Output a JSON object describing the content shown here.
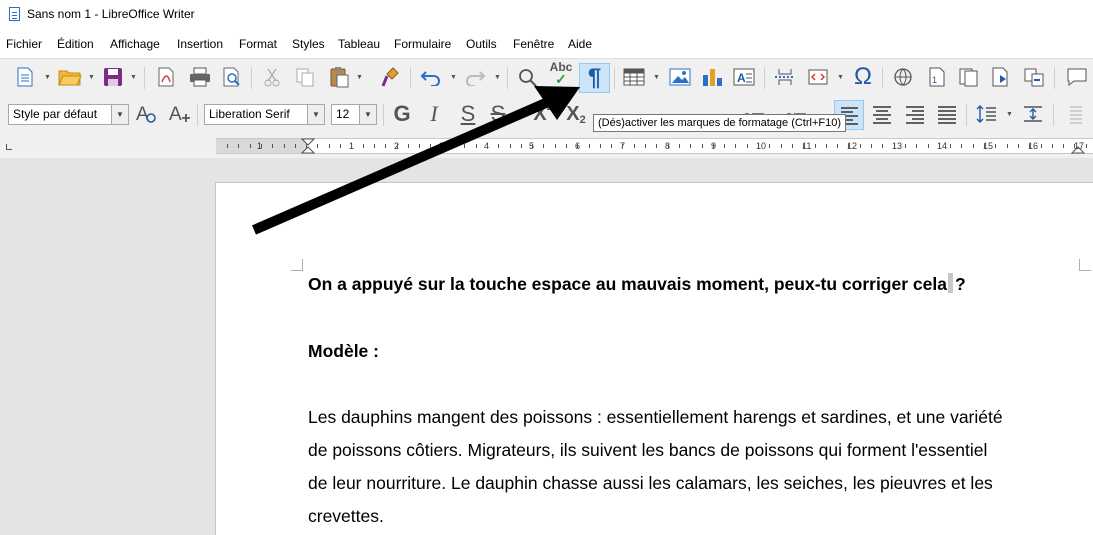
{
  "window": {
    "title": "Sans nom 1 - LibreOffice Writer"
  },
  "menu": [
    "Fichier",
    "Édition",
    "Affichage",
    "Insertion",
    "Format",
    "Styles",
    "Tableau",
    "Formulaire",
    "Outils",
    "Fenêtre",
    "Aide"
  ],
  "toolbar": {
    "spellcheck_label": "Abc",
    "pilcrow_glyph": "¶",
    "omega_glyph": "Ω",
    "paragraph_style": "Style par défaut",
    "font_name": "Liberation Serif",
    "font_size": "12",
    "bold_glyph": "G",
    "italic_glyph": "I",
    "underline_glyph": "S",
    "strike_glyph": "S",
    "superscript_label": "X",
    "superscript_mark": "2",
    "subscript_label": "X",
    "subscript_mark": "2"
  },
  "tooltip": "(Dés)activer les marques de formatage (Ctrl+F10)",
  "ruler": {
    "numbers": [
      "1",
      "1",
      "2",
      "3",
      "4",
      "5",
      "6",
      "7",
      "8",
      "9",
      "10",
      "11",
      "12",
      "13",
      "14",
      "15",
      "16",
      "17"
    ]
  },
  "document": {
    "question_before_cursor": "On a appuyé sur la touche espace au mauvais moment, peux-tu corriger cela",
    "question_after_cursor": "?",
    "model_heading": "Modèle :",
    "paragraph_lines": [
      "Les dauphins mangent des poissons : essentiellement harengs et sardines, et une variété",
      "de poissons côtiers. Migrateurs, ils suivent les bancs de poissons qui forment l'essentiel",
      "de leur nourriture. Le dauphin chasse aussi les calamars, les seiches, les pieuvres et les",
      "crevettes."
    ]
  },
  "colors": {
    "accent": "#1e5aa6",
    "highlight": "#cce4f7",
    "arrow": "#000000"
  }
}
